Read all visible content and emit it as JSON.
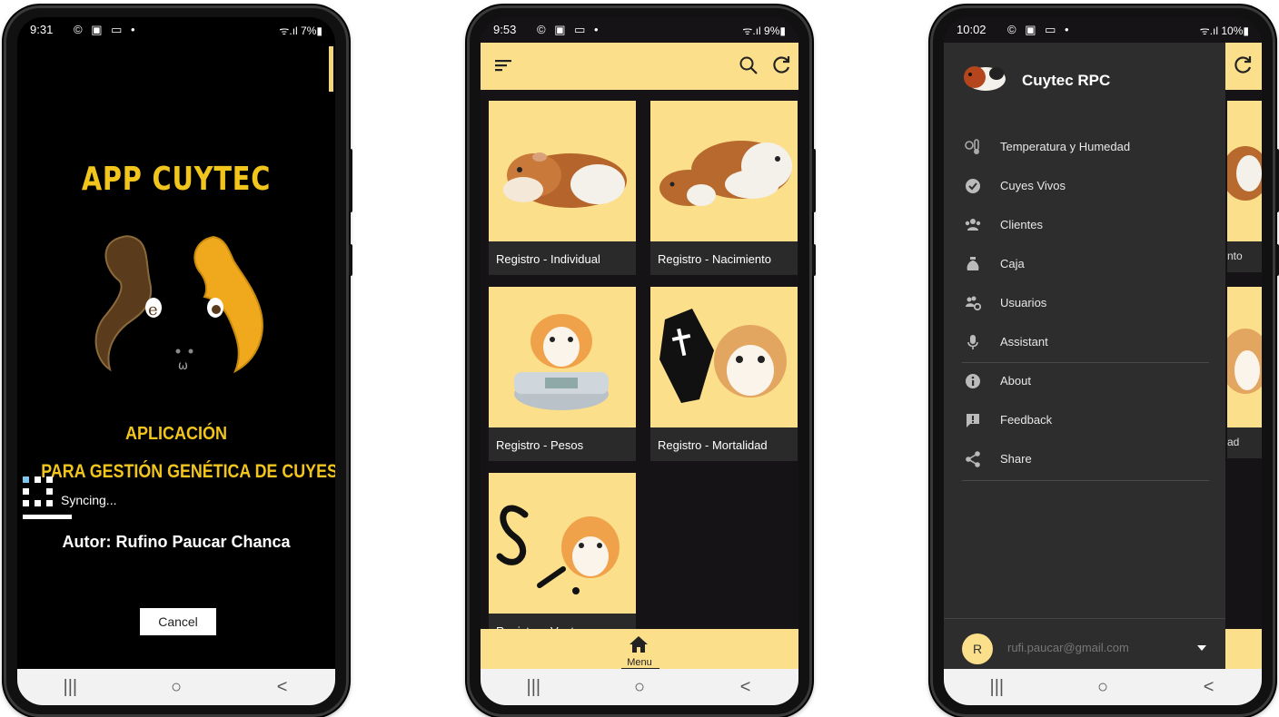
{
  "colors": {
    "accent": "#fbdf8b",
    "title_yellow": "#f2c51d",
    "dark_bg": "#151315",
    "drawer_bg": "#2d2d2d"
  },
  "phone1": {
    "status": {
      "time": "9:31",
      "icons": "© ▣ ▭ •",
      "right": "ᯤ.ıl 7%▮"
    },
    "title": "APP CUYTEC",
    "subtitle1": "APLICACIÓN",
    "subtitle2": "PARA GESTIÓN GENÉTICA DE CUYES",
    "author": "Autor: Rufino Paucar Chanca",
    "syncing": "Syncing...",
    "cancel": "Cancel",
    "nav": [
      "|||",
      "○",
      "<"
    ]
  },
  "phone2": {
    "status": {
      "time": "9:53",
      "icons": "© ▣ ▭ •",
      "right": "ᯤ.ıl 9%▮"
    },
    "icons": [
      "menu-icon",
      "search-icon",
      "refresh-icon"
    ],
    "cards": [
      {
        "label": "Registro - Individual"
      },
      {
        "label": "Registro - Nacimiento"
      },
      {
        "label": "Registro - Pesos"
      },
      {
        "label": "Registro - Mortalidad"
      },
      {
        "label": "Registro - Ventas"
      }
    ],
    "bottom_nav": {
      "label": "Menu"
    },
    "nav": [
      "|||",
      "○",
      "<"
    ]
  },
  "phone3": {
    "status": {
      "time": "10:02",
      "icons": "© ▣ ▭ •",
      "right": "ᯤ.ıl 10%▮"
    },
    "drawer_title": "Cuytec RPC",
    "items": [
      {
        "label": "Temperatura y Humedad",
        "icon": "thermometer-icon"
      },
      {
        "label": "Cuyes Vivos",
        "icon": "check-circle-icon"
      },
      {
        "label": "Clientes",
        "icon": "users-icon"
      },
      {
        "label": "Caja",
        "icon": "money-bag-icon"
      },
      {
        "label": "Usuarios",
        "icon": "user-settings-icon"
      },
      {
        "label": "Assistant",
        "icon": "microphone-icon"
      },
      {
        "label": "About",
        "icon": "info-icon"
      },
      {
        "label": "Feedback",
        "icon": "feedback-icon"
      },
      {
        "label": "Share",
        "icon": "share-icon"
      }
    ],
    "background_labels": [
      "nto",
      "ad"
    ],
    "account": {
      "initial": "R",
      "email": "rufi.paucar@gmail.com"
    },
    "nav": [
      "|||",
      "○",
      "<"
    ]
  }
}
